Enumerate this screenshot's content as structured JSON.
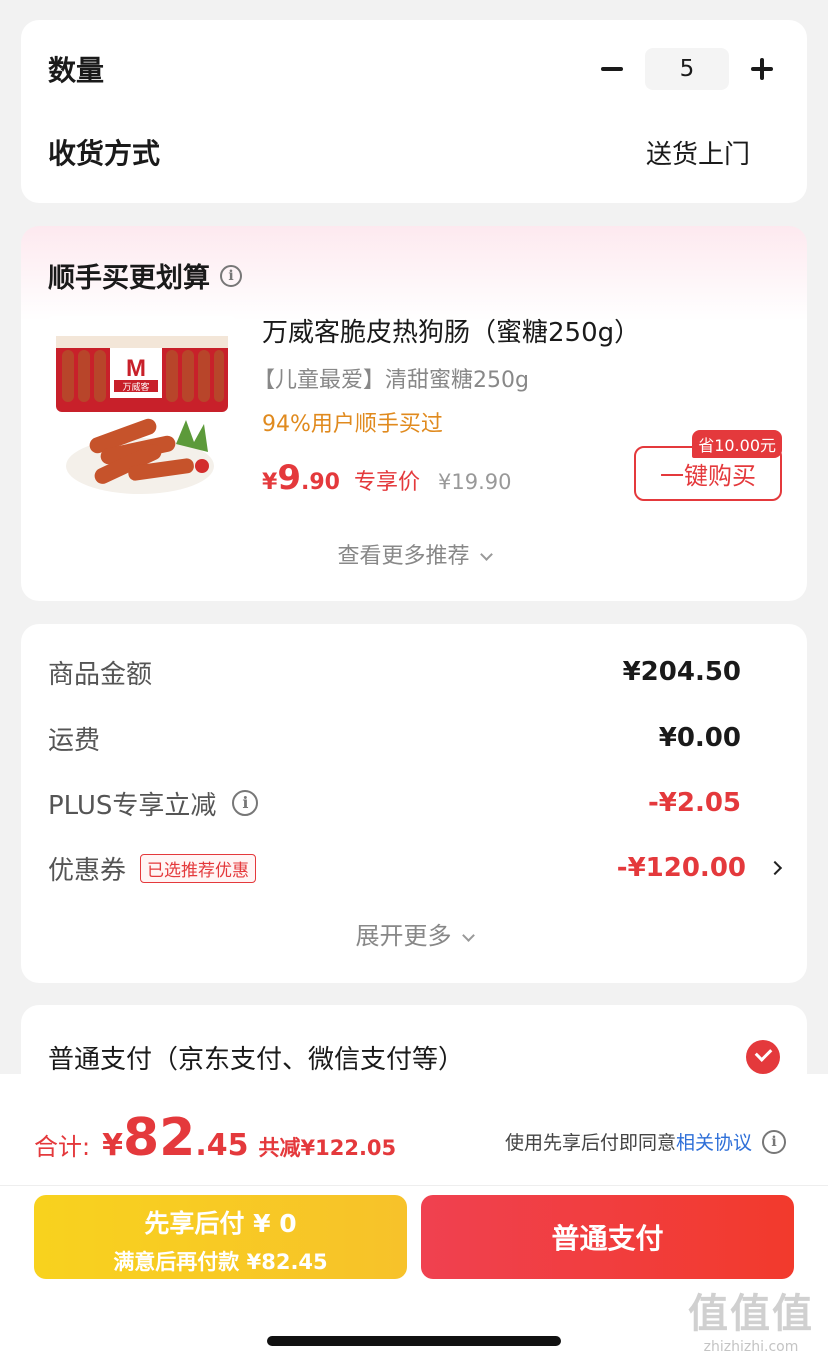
{
  "quantity": {
    "label": "数量",
    "value": "5"
  },
  "delivery": {
    "label": "收货方式",
    "value": "送货上门"
  },
  "addon": {
    "title": "顺手买更划算",
    "product": {
      "name": "万威客脆皮热狗肠（蜜糖250g）",
      "spec": "【儿童最爱】清甜蜜糖250g",
      "stat": "94%用户顺手买过",
      "currency": "¥",
      "price_int": "9",
      "price_dec": ".90",
      "price_tag": "专享价",
      "orig_price": "¥19.90",
      "save_tag": "省10.00元",
      "buy_label": "一键购买",
      "package_brand": "M",
      "package_name": "万威客"
    },
    "more_label": "查看更多推荐"
  },
  "fees": {
    "goods": {
      "label": "商品金额",
      "value": "¥204.50"
    },
    "shipping": {
      "label": "运费",
      "value": "¥0.00"
    },
    "plus": {
      "label": "PLUS专享立减",
      "value": "-¥2.05"
    },
    "coupon": {
      "label": "优惠券",
      "tag": "已选推荐优惠",
      "value": "-¥120.00"
    },
    "expand_label": "展开更多"
  },
  "payment": {
    "option": "普通支付（京东支付、微信支付等）"
  },
  "summary": {
    "total_label": "合计:",
    "currency": "¥",
    "total_int": "82",
    "total_dec": ".45",
    "saved": "共减¥122.05",
    "agreement_prefix": "使用先享后付即同意",
    "agreement_link": "相关协议"
  },
  "actions": {
    "paylater_line1": "先享后付 ¥ 0",
    "paylater_line2": "满意后再付款 ¥82.45",
    "pay_label": "普通支付"
  },
  "watermark": {
    "logo": "值值值",
    "domain": "zhizhizhi.com"
  },
  "colors": {
    "accent": "#e4393c",
    "orange": "#e08a1e",
    "yellow": "#f8d21e"
  }
}
